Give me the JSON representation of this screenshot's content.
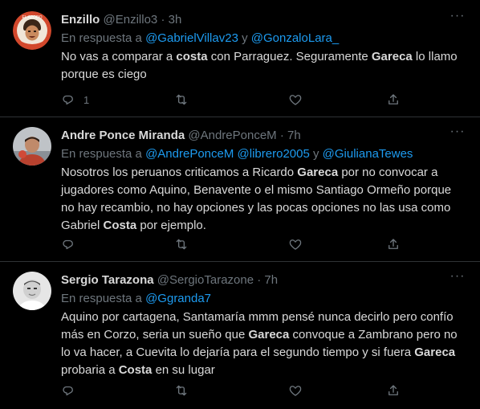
{
  "tweets": [
    {
      "name": "Enzillo",
      "handle": "@Enzillo3",
      "dot": "·",
      "time": "3h",
      "reply_prefix": "En respuesta a",
      "mention1": "@GabrielVillav23",
      "conj": "y",
      "mention2": "@GonzaloLara_",
      "text_parts": [
        "No vas a comparar a ",
        "costa",
        " con Parraguez. Seguramente ",
        "Gareca",
        " lo llamo porque es ciego"
      ],
      "reply_count": "1"
    },
    {
      "name": "Andre Ponce Miranda",
      "handle": "@AndrePonceM",
      "dot": "·",
      "time": "7h",
      "reply_prefix": "En respuesta a",
      "mention1": "@AndrePonceM",
      "mention2": "@librero2005",
      "conj": "y",
      "mention3": "@GiulianaTewes",
      "text_parts": [
        "Nosotros los peruanos criticamos a Ricardo ",
        "Gareca",
        " por no convocar a jugadores como Aquino, Benavente o el mismo Santiago Ormeño porque no hay recambio, no hay opciones y las pocas opciones no las usa como Gabriel ",
        "Costa",
        " por ejemplo."
      ]
    },
    {
      "name": "Sergio Tarazona",
      "handle": "@SergioTarazone",
      "dot": "·",
      "time": "7h",
      "reply_prefix": "En respuesta a",
      "mention1": "@Ggranda7",
      "text_parts": [
        "Aquino por cartagena, Santamaría mmm pensé nunca decirlo pero confío más en Corzo, seria un sueño que ",
        "Gareca",
        " convoque a Zambrano pero no lo va hacer, a Cuevita lo dejaría para el segundo tiempo y si fuera ",
        "Gareca",
        " probaria a ",
        "Costa",
        " en su lugar"
      ]
    }
  ],
  "icons": {
    "more": "more-horizontal-icon",
    "reply": "reply-icon",
    "retweet": "retweet-icon",
    "like": "heart-icon",
    "share": "share-icon"
  },
  "colors": {
    "background": "#000000",
    "text": "#d9d9d9",
    "muted": "#6e767d",
    "link": "#1d9bf0",
    "divider": "#2f3336"
  }
}
